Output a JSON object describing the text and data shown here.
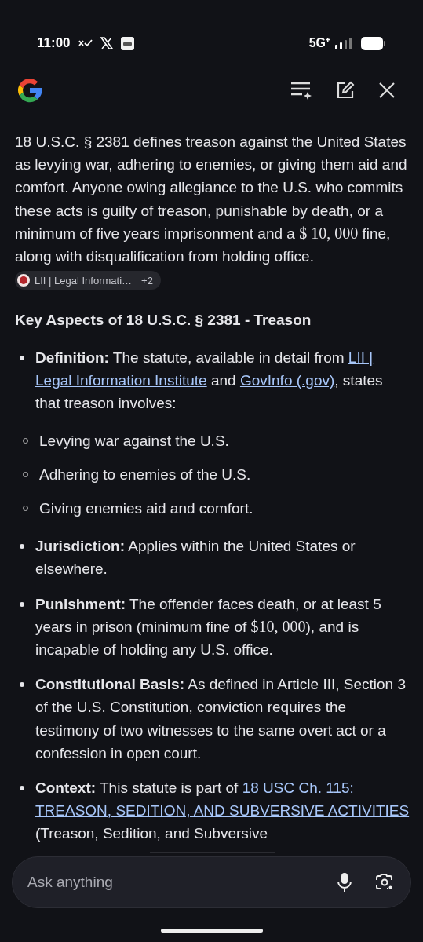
{
  "status_bar": {
    "time": "11:00",
    "network": "5G⁺"
  },
  "intro": {
    "segments": [
      {
        "kind": "plain",
        "text": "18 U.S.C. § 2381 defines treason against the United States as levying war, adhering to enemies, or giving them aid and comfort. Anyone owing allegiance to the U.S. who commits these acts is guilty of treason, punishable by death, or a minimum of five years imprisonment and a "
      },
      {
        "kind": "math",
        "text": "$ 10, 000"
      },
      {
        "kind": "plain",
        "text": " fine, along with disqualification from holding office."
      }
    ],
    "source_chip": {
      "label": "LII | Legal Informati…",
      "more": "+2"
    }
  },
  "heading": "Key Aspects of 18 U.S.C. § 2381 - Treason",
  "bullets": [
    {
      "term": "Definition:",
      "segments": [
        {
          "kind": "plain",
          "text": " The statute, available in detail from "
        },
        {
          "kind": "link",
          "text": "LII |"
        },
        {
          "kind": "link",
          "text": "Legal Information Institute"
        },
        {
          "kind": "plain",
          "text": " and "
        },
        {
          "kind": "link",
          "text": "GovInfo (.gov)"
        },
        {
          "kind": "plain",
          "text": ", states that treason involves:"
        }
      ],
      "children": [
        "Levying war against the U.S.",
        "Adhering to enemies of the U.S.",
        "Giving enemies aid and comfort."
      ]
    },
    {
      "term": "Jurisdiction:",
      "segments": [
        {
          "kind": "plain",
          "text": " Applies within the United States or elsewhere."
        }
      ]
    },
    {
      "term": "Punishment:",
      "segments": [
        {
          "kind": "plain",
          "text": " The offender faces death, or at least 5 years in prison (minimum fine of "
        },
        {
          "kind": "math",
          "text": "$10, 000"
        },
        {
          "kind": "plain",
          "text": "), and is incapable of holding any U.S. office."
        }
      ]
    },
    {
      "term": "Constitutional Basis:",
      "segments": [
        {
          "kind": "plain",
          "text": " As defined in Article III, Section 3 of the U.S. Constitution, conviction requires the testimony of two witnesses to the same overt act or a confession in open court."
        }
      ]
    },
    {
      "term": "Context:",
      "segments": [
        {
          "kind": "plain",
          "text": " This statute is part of "
        },
        {
          "kind": "link",
          "text": "18 USC Ch. 115:"
        },
        {
          "kind": "link",
          "text": "TREASON, SEDITION, AND SUBVERSIVE ACTIVITIES"
        },
        {
          "kind": "plain",
          "text": " (Treason, Sedition, and Subversive"
        }
      ]
    }
  ],
  "input": {
    "placeholder": "Ask anything"
  }
}
